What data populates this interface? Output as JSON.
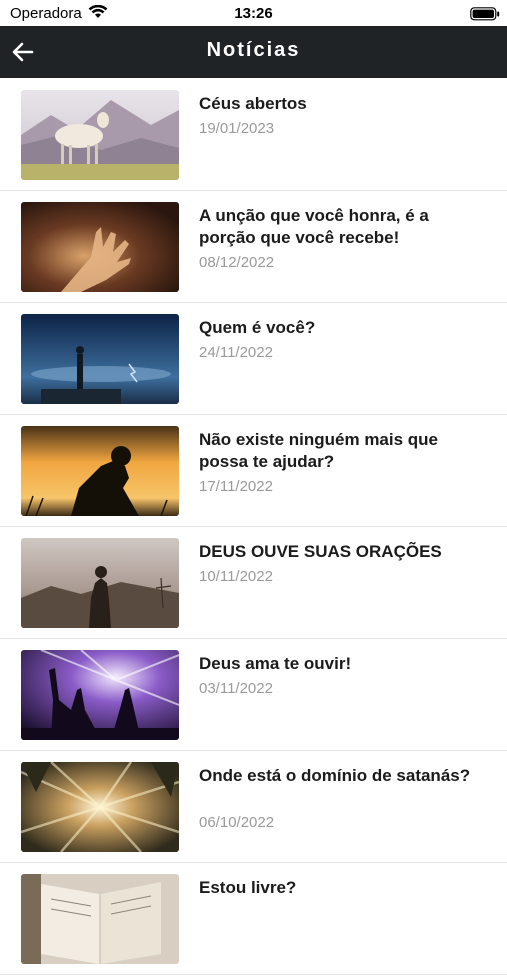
{
  "status": {
    "carrier": "Operadora",
    "time": "13:26"
  },
  "header": {
    "title": "Notícias",
    "back_icon": "arrow-left-icon"
  },
  "news": [
    {
      "title": "Céus abertos",
      "date": "19/01/2023"
    },
    {
      "title": "A unção que você honra, é a porção que você recebe!",
      "date": "08/12/2022"
    },
    {
      "title": "Quem é você?",
      "date": "24/11/2022"
    },
    {
      "title": "Não existe ninguém mais que possa te ajudar?",
      "date": "17/11/2022"
    },
    {
      "title": "DEUS OUVE SUAS ORAÇÕES",
      "date": "10/11/2022"
    },
    {
      "title": "Deus ama te ouvir!",
      "date": "03/11/2022"
    },
    {
      "title": "Onde está o domínio de satanás?",
      "date": "06/10/2022"
    },
    {
      "title": "Estou livre?",
      "date": ""
    }
  ],
  "colors": {
    "header_bg": "#1f2326",
    "title_text": "#1b1b1b",
    "date_text": "#9a9a9a"
  }
}
